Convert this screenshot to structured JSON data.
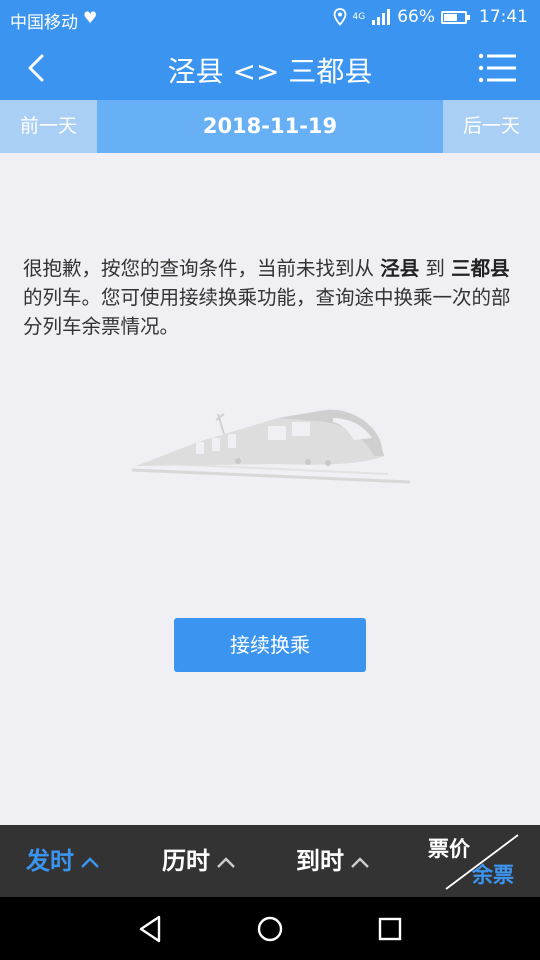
{
  "status_bar": {
    "carrier": "中国移动",
    "network": "4G",
    "battery": "66%",
    "battery_level": 0.66,
    "time": "17:41"
  },
  "nav": {
    "title": "泾县 <> 三都县"
  },
  "date_bar": {
    "prev_label": "前一天",
    "date": "2018-11-19",
    "next_label": "后一天"
  },
  "message": {
    "p1": "很抱歉，按您的查询条件，当前未找到从 ",
    "from": "泾县",
    "p2": " 到 ",
    "to": "三都县",
    "p3": " 的列车。您可使用接续换乘功能，查询途中换乘一次的部分列车余票情况。"
  },
  "transfer_button": "接续换乘",
  "sort_bar": {
    "depart": "发时",
    "duration": "历时",
    "arrive": "到时",
    "price": "票价",
    "remaining": "余票"
  },
  "colors": {
    "accent": "#3b95f0",
    "sort_bar_bg": "#333333"
  }
}
